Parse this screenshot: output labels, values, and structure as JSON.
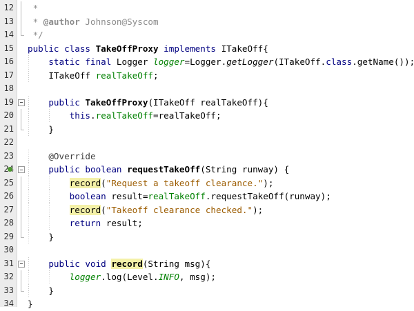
{
  "editor": {
    "lines": [
      {
        "n": "12",
        "tokens": [
          {
            "t": " *",
            "c": "cm"
          }
        ]
      },
      {
        "n": "13",
        "tokens": [
          {
            "t": " * ",
            "c": "cm"
          },
          {
            "t": "@author",
            "c": "cmtag"
          },
          {
            "t": " Johnson@Syscom",
            "c": "cm"
          }
        ]
      },
      {
        "n": "14",
        "tokens": [
          {
            "t": " */",
            "c": "cm"
          }
        ]
      },
      {
        "n": "15",
        "tokens": [
          {
            "t": "public class ",
            "c": "kw"
          },
          {
            "t": "TakeOffProxy",
            "c": "decl"
          },
          {
            "t": " ",
            "c": ""
          },
          {
            "t": "implements",
            "c": "kw"
          },
          {
            "t": " ITakeOff{",
            "c": ""
          }
        ]
      },
      {
        "n": "16",
        "tokens": [
          {
            "t": "    ",
            "c": ""
          },
          {
            "t": "static final",
            "c": "kw"
          },
          {
            "t": " Logger ",
            "c": ""
          },
          {
            "t": "logger",
            "c": "sfld"
          },
          {
            "t": "=Logger.",
            "c": ""
          },
          {
            "t": "getLogger",
            "c": "italic"
          },
          {
            "t": "(ITakeOff.",
            "c": ""
          },
          {
            "t": "class",
            "c": "kw"
          },
          {
            "t": ".getName());",
            "c": ""
          }
        ]
      },
      {
        "n": "17",
        "tokens": [
          {
            "t": "    ITakeOff ",
            "c": ""
          },
          {
            "t": "realTakeOff",
            "c": "fld"
          },
          {
            "t": ";",
            "c": ""
          }
        ]
      },
      {
        "n": "18",
        "tokens": []
      },
      {
        "n": "19",
        "tokens": [
          {
            "t": "    ",
            "c": ""
          },
          {
            "t": "public",
            "c": "kw"
          },
          {
            "t": " ",
            "c": ""
          },
          {
            "t": "TakeOffProxy",
            "c": "decl"
          },
          {
            "t": "(ITakeOff realTakeOff){",
            "c": ""
          }
        ]
      },
      {
        "n": "20",
        "tokens": [
          {
            "t": "        ",
            "c": ""
          },
          {
            "t": "this",
            "c": "kw"
          },
          {
            "t": ".",
            "c": ""
          },
          {
            "t": "realTakeOff",
            "c": "fld"
          },
          {
            "t": "=realTakeOff;",
            "c": ""
          }
        ]
      },
      {
        "n": "21",
        "tokens": [
          {
            "t": "    }",
            "c": ""
          }
        ]
      },
      {
        "n": "22",
        "tokens": []
      },
      {
        "n": "23",
        "tokens": [
          {
            "t": "    @Override",
            "c": "ann"
          }
        ]
      },
      {
        "n": "24",
        "tokens": [
          {
            "t": "    ",
            "c": ""
          },
          {
            "t": "public boolean",
            "c": "kw"
          },
          {
            "t": " ",
            "c": ""
          },
          {
            "t": "requestTakeOff",
            "c": "decl"
          },
          {
            "t": "(String runway) {",
            "c": ""
          }
        ]
      },
      {
        "n": "25",
        "tokens": [
          {
            "t": "        ",
            "c": ""
          },
          {
            "t": "record",
            "c": "hl"
          },
          {
            "t": "(",
            "c": ""
          },
          {
            "t": "\"Request a takeoff clearance.\"",
            "c": "str"
          },
          {
            "t": ");",
            "c": ""
          }
        ]
      },
      {
        "n": "26",
        "tokens": [
          {
            "t": "        ",
            "c": ""
          },
          {
            "t": "boolean",
            "c": "kw"
          },
          {
            "t": " result=",
            "c": ""
          },
          {
            "t": "realTakeOff",
            "c": "fld"
          },
          {
            "t": ".requestTakeOff(runway);",
            "c": ""
          }
        ]
      },
      {
        "n": "27",
        "tokens": [
          {
            "t": "        ",
            "c": ""
          },
          {
            "t": "record",
            "c": "hl"
          },
          {
            "t": "(",
            "c": ""
          },
          {
            "t": "\"Takeoff clearance checked.\"",
            "c": "str"
          },
          {
            "t": ");",
            "c": ""
          }
        ]
      },
      {
        "n": "28",
        "tokens": [
          {
            "t": "        ",
            "c": ""
          },
          {
            "t": "return",
            "c": "kw"
          },
          {
            "t": " result;",
            "c": ""
          }
        ]
      },
      {
        "n": "29",
        "tokens": [
          {
            "t": "    }",
            "c": ""
          }
        ]
      },
      {
        "n": "30",
        "tokens": []
      },
      {
        "n": "31",
        "tokens": [
          {
            "t": "    ",
            "c": ""
          },
          {
            "t": "public void",
            "c": "kw"
          },
          {
            "t": " ",
            "c": ""
          },
          {
            "t": "record",
            "c": "hl bold"
          },
          {
            "t": "(String msg){",
            "c": ""
          }
        ]
      },
      {
        "n": "32",
        "tokens": [
          {
            "t": "        ",
            "c": ""
          },
          {
            "t": "logger",
            "c": "sfld"
          },
          {
            "t": ".log(Level.",
            "c": ""
          },
          {
            "t": "INFO",
            "c": "sfld"
          },
          {
            "t": ", msg);",
            "c": ""
          }
        ]
      },
      {
        "n": "33",
        "tokens": [
          {
            "t": "    }",
            "c": ""
          }
        ]
      },
      {
        "n": "34",
        "tokens": [
          {
            "t": "}",
            "c": ""
          }
        ]
      }
    ]
  }
}
